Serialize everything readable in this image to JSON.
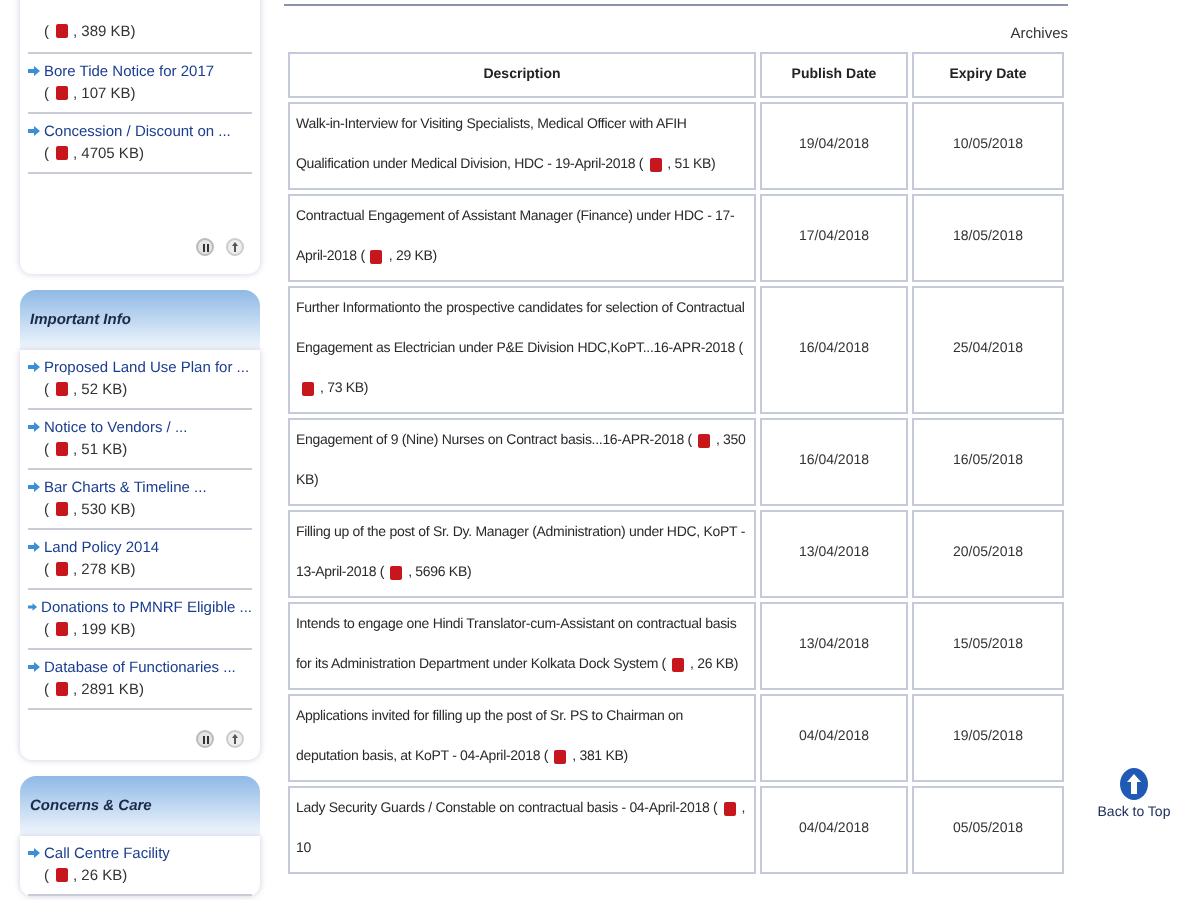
{
  "sidebar": {
    "panels": [
      {
        "items": [
          {
            "open": "(",
            "size": ", 389 KB)"
          },
          {
            "title": "Bore Tide Notice for 2017",
            "open": "(",
            "size": ", 107 KB)"
          },
          {
            "title": "Concession / Discount on ...",
            "open": "(",
            "size": ", 4705 KB)"
          }
        ],
        "controls": true
      },
      {
        "title": "Important Info",
        "items": [
          {
            "title": "Proposed Land Use Plan for ...",
            "open": "(",
            "size": ", 52 KB)"
          },
          {
            "title": "Notice to Vendors / ...",
            "open": "(",
            "size": ", 51 KB)"
          },
          {
            "title": "Bar Charts & Timeline ...",
            "open": "(",
            "size": ", 530 KB)"
          },
          {
            "title": "Land Policy 2014",
            "open": "(",
            "size": ", 278 KB)"
          },
          {
            "title": "Donations to PMNRF Eligible ...",
            "open": "(",
            "size": ", 199 KB)"
          },
          {
            "title": "Database of Functionaries ...",
            "open": "(",
            "size": ", 2891 KB)"
          }
        ],
        "controls": true
      },
      {
        "title": "Concerns & Care",
        "items": [
          {
            "title": "Call Centre Facility",
            "open": "(",
            "size": ", 26 KB)"
          }
        ],
        "controls": false
      }
    ]
  },
  "archives_link": "Archives",
  "table": {
    "columns": [
      "Description",
      "Publish Date",
      "Expiry Date"
    ],
    "rows": [
      {
        "description": "Walk-in-Interview for Visiting Specialists, Medical Officer with AFIH Qualification under Medical Division, HDC - 19-April-2018 (",
        "size": ", 51 KB)",
        "publish": "19/04/2018",
        "expiry": "10/05/2018"
      },
      {
        "description": "Contractual Engagement of Assistant Manager (Finance) under HDC - 17-April-2018 (",
        "size": ", 29 KB)",
        "publish": "17/04/2018",
        "expiry": "18/05/2018"
      },
      {
        "description": "Further Informationto the prospective candidates for selection of Contractual Engagement as Electrician under P&E Division HDC,KoPT...16-APR-2018 (",
        "size": ", 73 KB)",
        "publish": "16/04/2018",
        "expiry": "25/04/2018"
      },
      {
        "description": "Engagement of 9 (Nine) Nurses on Contract basis...16-APR-2018 (",
        "size": ", 350 KB)",
        "publish": "16/04/2018",
        "expiry": "16/05/2018"
      },
      {
        "description": "Filling up of the post of Sr. Dy. Manager (Administration) under HDC, KoPT - 13-April-2018 (",
        "size": ", 5696 KB)",
        "publish": "13/04/2018",
        "expiry": "20/05/2018"
      },
      {
        "description": "Intends to engage one Hindi Translator-cum-Assistant on contractual basis for its Administration Department under Kolkata Dock System (",
        "size": ", 26 KB)",
        "publish": "13/04/2018",
        "expiry": "15/05/2018"
      },
      {
        "description": "Applications invited for filling up the post of Sr. PS to Chairman on deputation basis, at KoPT - 04-April-2018 (",
        "size": ", 381 KB)",
        "publish": "04/04/2018",
        "expiry": "19/05/2018"
      },
      {
        "description": "Lady Security Guards / Constable on contractual basis - 04-April-2018 (",
        "size": ", 10",
        "publish": "04/04/2018",
        "expiry": "05/05/2018"
      }
    ]
  },
  "back_to_top": "Back to Top"
}
